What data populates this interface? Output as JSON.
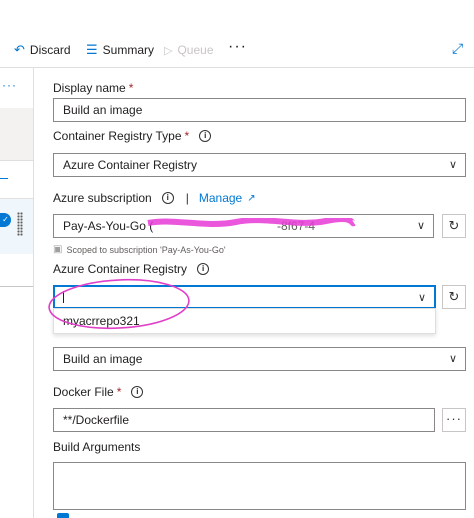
{
  "toolbar": {
    "discard_label": "Discard",
    "summary_label": "Summary",
    "queue_label": "Queue",
    "more_label": "···",
    "icons": {
      "discard": "undo-icon",
      "summary": "list-icon",
      "queue": "play-icon",
      "expand": "expand-icon"
    }
  },
  "left_panel": {
    "more_label": "···"
  },
  "form": {
    "display_name": {
      "label": "Display name",
      "required": "*",
      "value": "Build an image"
    },
    "registry_type": {
      "label": "Container Registry Type",
      "required": "*",
      "value": "Azure Container Registry"
    },
    "subscription": {
      "label": "Azure subscription",
      "separator": "|",
      "manage_label": "Manage",
      "value": "Pay-As-You-Go (",
      "value_suffix": "-8f67-4",
      "scoped_text": "Scoped to subscription 'Pay-As-You-Go'"
    },
    "acr": {
      "label": "Azure Container Registry",
      "value": "",
      "option": "myacrrepo321"
    },
    "command": {
      "value": "Build an image"
    },
    "docker_file": {
      "label": "Docker File",
      "required": "*",
      "value": "**/Dockerfile",
      "more_label": "···"
    },
    "build_args": {
      "label": "Build Arguments"
    }
  },
  "colors": {
    "accent": "#0078d4",
    "required": "#a4262c",
    "annotation": "#e040c8",
    "redaction": "#e83ad6"
  }
}
